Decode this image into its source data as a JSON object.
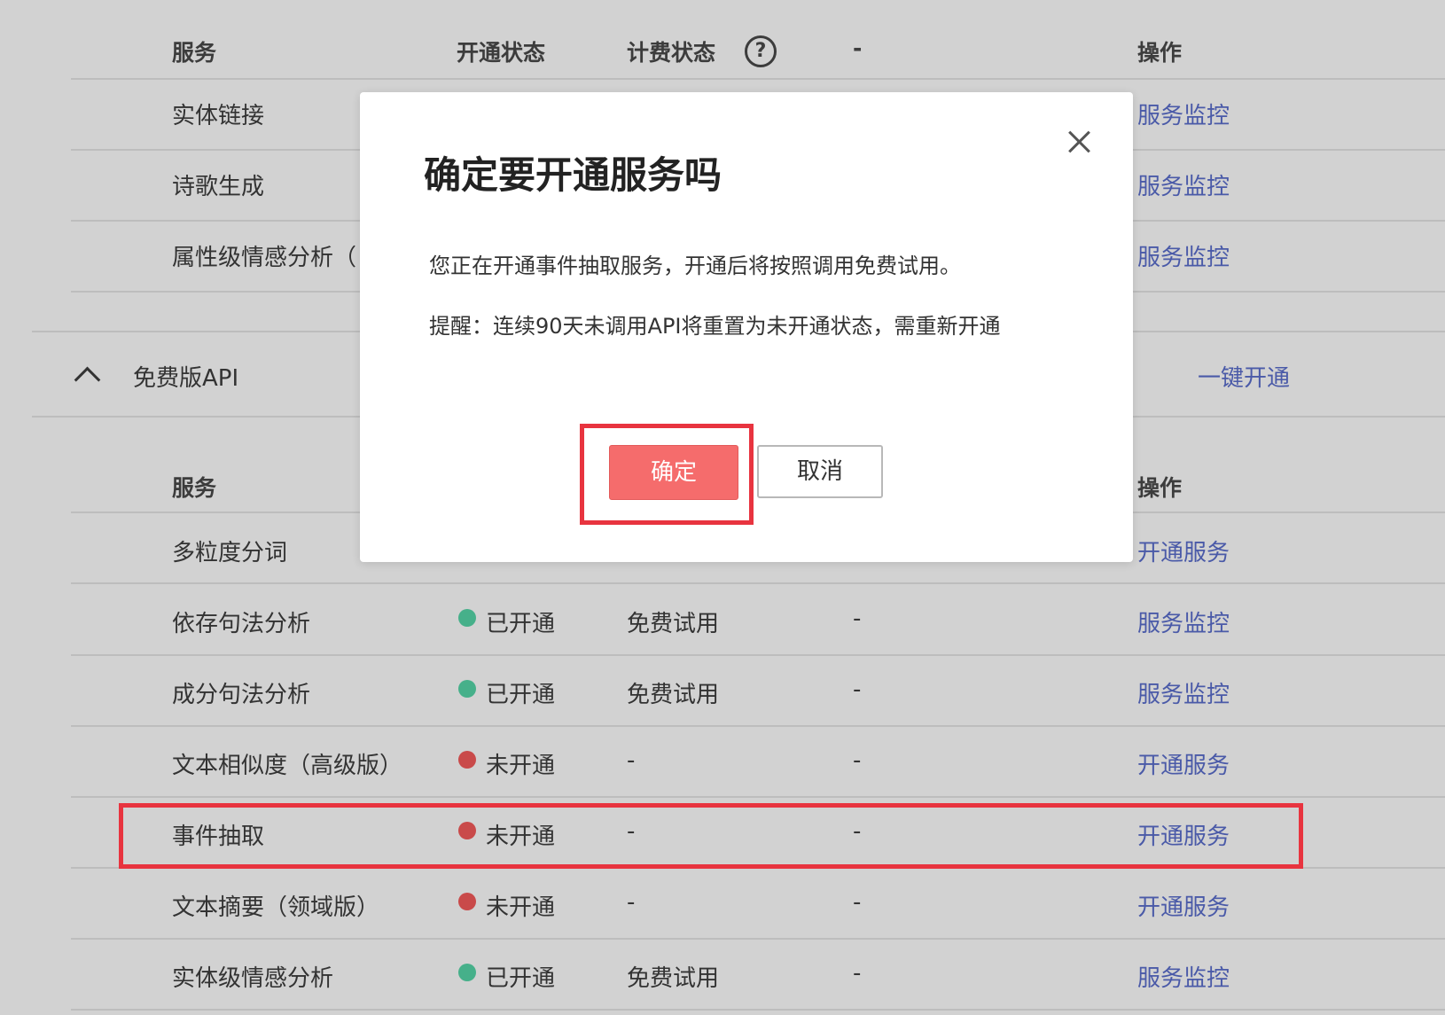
{
  "top_table": {
    "headers": {
      "service": "服务",
      "status": "开通状态",
      "billing": "计费状态",
      "extra": "-",
      "action": "操作"
    },
    "rows": [
      {
        "name": "实体链接",
        "action": "服务监控"
      },
      {
        "name": "诗歌生成",
        "action": "服务监控"
      },
      {
        "name": "属性级情感分析（",
        "action": "服务监控"
      }
    ]
  },
  "free_section": {
    "title": "免费版API",
    "one_click": "一键开通",
    "headers": {
      "service": "服务",
      "action": "操作"
    },
    "rows": [
      {
        "name": "多粒度分词",
        "status": "",
        "billing": "",
        "extra": "",
        "action": "开通服务"
      },
      {
        "name": "依存句法分析",
        "status": "已开通",
        "billing": "免费试用",
        "extra": "-",
        "action": "服务监控"
      },
      {
        "name": "成分句法分析",
        "status": "已开通",
        "billing": "免费试用",
        "extra": "-",
        "action": "服务监控"
      },
      {
        "name": "文本相似度（高级版）",
        "status": "未开通",
        "billing": "-",
        "extra": "-",
        "action": "开通服务"
      },
      {
        "name": "事件抽取",
        "status": "未开通",
        "billing": "-",
        "extra": "-",
        "action": "开通服务"
      },
      {
        "name": "文本摘要（领域版）",
        "status": "未开通",
        "billing": "-",
        "extra": "-",
        "action": "开通服务"
      },
      {
        "name": "实体级情感分析",
        "status": "已开通",
        "billing": "免费试用",
        "extra": "-",
        "action": "服务监控"
      }
    ]
  },
  "modal": {
    "title": "确定要开通服务吗",
    "message": "您正在开通事件抽取服务，开通后将按照调用免费试用。",
    "reminder": "提醒：连续90天未调用API将重置为未开通状态，需重新开通",
    "confirm_label": "确定",
    "cancel_label": "取消"
  },
  "colors": {
    "status_on": "#46b08a",
    "status_off": "#c94a4a",
    "link": "#4a5aa8",
    "confirm_button": "#f56c6c",
    "highlight": "#e8343f"
  },
  "icons": {
    "help": "question-circle-icon",
    "collapse": "chevron-up-icon",
    "close": "close-icon"
  }
}
